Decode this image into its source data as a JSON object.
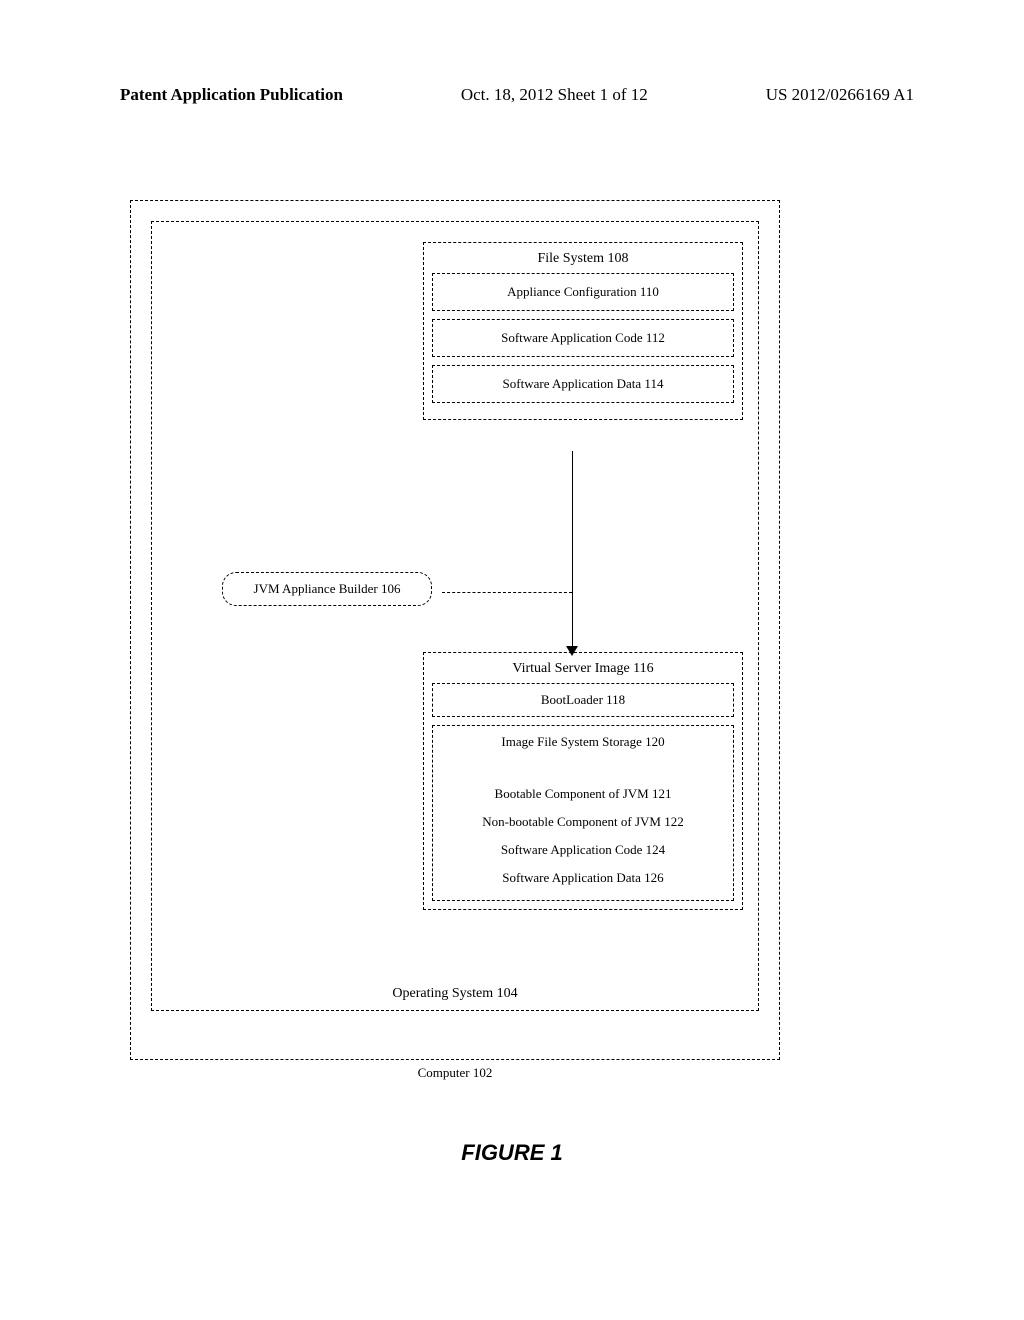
{
  "header": {
    "left": "Patent Application Publication",
    "center": "Oct. 18, 2012  Sheet 1 of 12",
    "right": "US 2012/0266169 A1"
  },
  "diagram": {
    "computer_label": "Computer 102",
    "os_label": "Operating System 104",
    "file_system": {
      "label": "File System 108",
      "items": [
        "Appliance Configuration 110",
        "Software Application Code 112",
        "Software Application Data 114"
      ]
    },
    "jvm_builder": "JVM Appliance Builder 106",
    "vsi": {
      "label": "Virtual Server Image 116",
      "bootloader": "BootLoader 118",
      "image_fs_label": "Image File System Storage 120",
      "image_fs_items": [
        "Bootable Component of JVM 121",
        "Non-bootable Component of JVM 122",
        "Software Application Code 124",
        "Software Application Data 126"
      ]
    }
  },
  "caption": "FIGURE 1"
}
